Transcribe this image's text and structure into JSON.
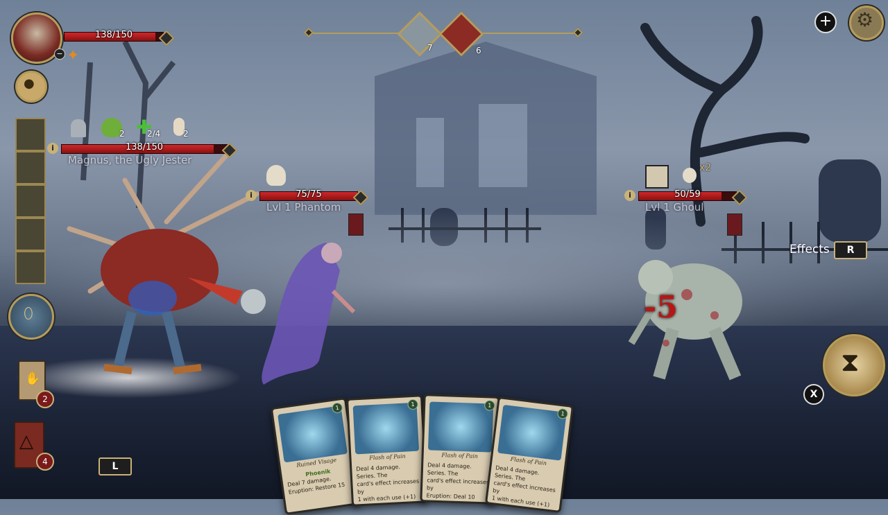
{
  "player": {
    "hp": "138/150",
    "hp_fraction": 0.92
  },
  "party": {
    "buffs": [
      {
        "icon": "tombstone-icon",
        "count": ""
      },
      {
        "icon": "jester-hat-icon",
        "count": "2"
      },
      {
        "icon": "heal-cross-icon",
        "count": "2/4"
      },
      {
        "icon": "bone-icon",
        "count": "2"
      }
    ],
    "hero": {
      "name": "Magnus, the Ugly Jester",
      "hp": "138/150",
      "hp_fraction": 0.92
    }
  },
  "turn_order": {
    "counts": [
      "7",
      "6"
    ]
  },
  "enemies": [
    {
      "name": "Lvl 1 Phantom",
      "hp": "75/75",
      "hp_fraction": 1.0
    },
    {
      "name": "Lvl 1 Ghoul",
      "hp": "50/59",
      "hp_fraction": 0.85,
      "multiplier": "x2"
    }
  ],
  "combat": {
    "damage_popup": "-5"
  },
  "effects": {
    "label": "Effects",
    "key": "R"
  },
  "keys": {
    "left": "L",
    "end_turn": "X"
  },
  "decks": {
    "draw_count": "2",
    "discard_count": "4"
  },
  "cards": [
    {
      "name": "Ruined Visage",
      "lines": [
        "Phoenik",
        "Deal 7 damage.",
        "Eruption: Restore 15"
      ],
      "cost": "1"
    },
    {
      "name": "Flash of Pain",
      "lines": [
        "Deal 4 damage. Series. The",
        "card's effect increases by",
        "1 with each use (+1)"
      ],
      "cost": "1"
    },
    {
      "name": "Flash of Pain",
      "lines": [
        "Deal 4 damage. Series. The",
        "card's effect increases by",
        "Eruption: Deal 10 damage"
      ],
      "cost": "1"
    },
    {
      "name": "Flash of Pain",
      "lines": [
        "Deal 4 damage. Series. The",
        "card's effect increases by",
        "1 with each use (+1)"
      ],
      "cost": "1"
    }
  ],
  "colors": {
    "hp_red": "#c8201f",
    "gold_trim": "#b59c5c",
    "damage_red": "#b81616"
  }
}
